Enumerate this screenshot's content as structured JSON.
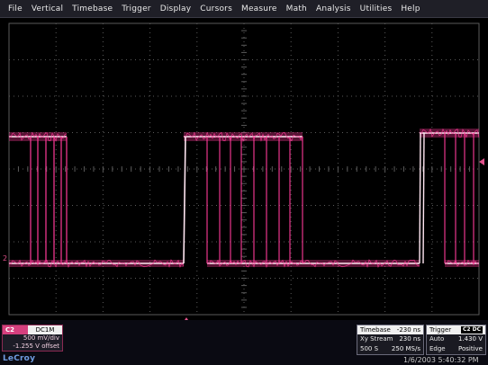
{
  "menu": [
    "File",
    "Vertical",
    "Timebase",
    "Trigger",
    "Display",
    "Cursors",
    "Measure",
    "Math",
    "Analysis",
    "Utilities",
    "Help"
  ],
  "channel": {
    "name": "C2",
    "measure": "DC1M",
    "vdiv": "500 mV/div",
    "offset": "-1.255 V offset"
  },
  "channel_marker": "2",
  "brand": "LeCroy",
  "timebase": {
    "label": "Timebase",
    "delay": "-230 ns",
    "mode": "Xy Stream",
    "tdiv": "230 ns",
    "samples": "500 S",
    "rate": "250 MS/s"
  },
  "trigger": {
    "label": "Trigger",
    "badge": "C2 DC",
    "mode": "Auto",
    "level": "1.430 V",
    "type": "Edge",
    "slope": "Positive"
  },
  "datetime": "1/6/2003 5:40:32 PM",
  "colors": {
    "trace": "#ff3a98",
    "grid": "#5a5a5a",
    "channel_accent": "#d6407e",
    "logo": "#6f9ce0"
  }
}
